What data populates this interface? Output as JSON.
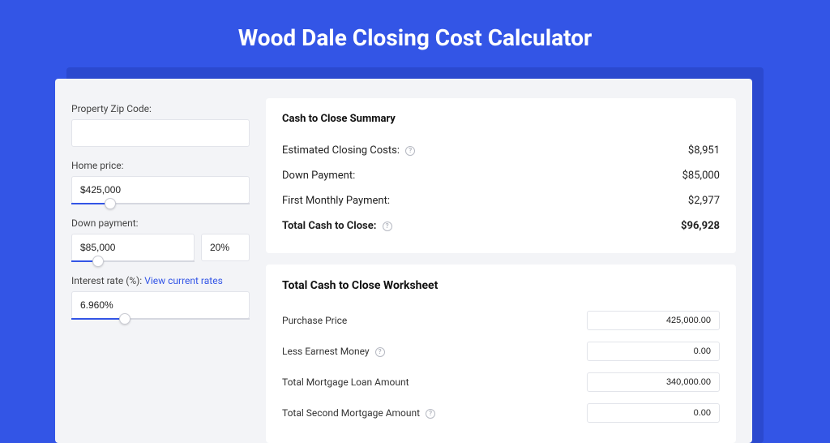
{
  "title": "Wood Dale Closing Cost Calculator",
  "form": {
    "zip": {
      "label": "Property Zip Code:",
      "value": ""
    },
    "home_price": {
      "label": "Home price:",
      "value": "$425,000",
      "slider_pct": 22
    },
    "down_payment": {
      "label": "Down payment:",
      "value": "$85,000",
      "percent": "20%",
      "slider_pct": 22
    },
    "interest_rate": {
      "label": "Interest rate (%):",
      "link": "View current rates",
      "value": "6.960%",
      "slider_pct": 30
    }
  },
  "summary": {
    "title": "Cash to Close Summary",
    "rows": [
      {
        "label": "Estimated Closing Costs:",
        "help": true,
        "value": "$8,951"
      },
      {
        "label": "Down Payment:",
        "help": false,
        "value": "$85,000"
      },
      {
        "label": "First Monthly Payment:",
        "help": false,
        "value": "$2,977"
      }
    ],
    "total": {
      "label": "Total Cash to Close:",
      "help": true,
      "value": "$96,928"
    }
  },
  "worksheet": {
    "title": "Total Cash to Close Worksheet",
    "rows": [
      {
        "label": "Purchase Price",
        "help": false,
        "value": "425,000.00"
      },
      {
        "label": "Less Earnest Money",
        "help": true,
        "value": "0.00"
      },
      {
        "label": "Total Mortgage Loan Amount",
        "help": false,
        "value": "340,000.00"
      },
      {
        "label": "Total Second Mortgage Amount",
        "help": true,
        "value": "0.00"
      }
    ]
  }
}
